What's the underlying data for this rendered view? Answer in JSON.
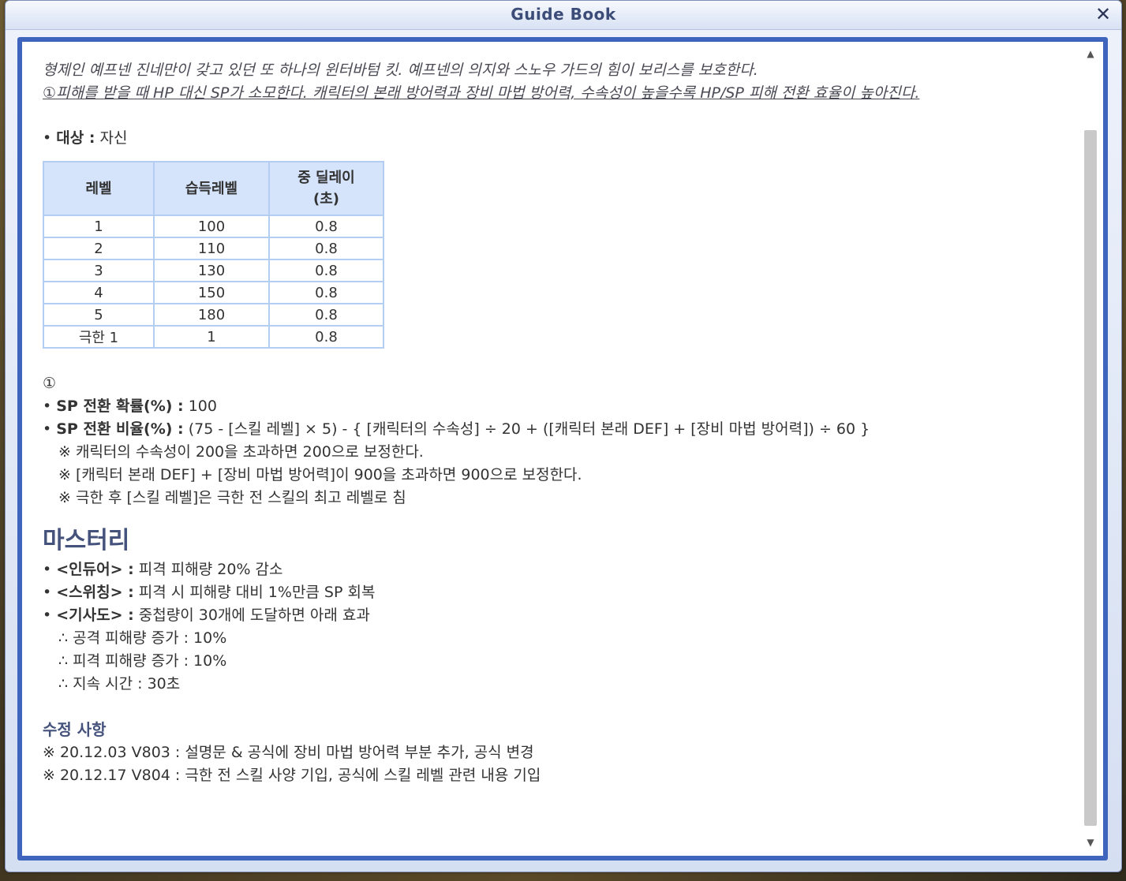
{
  "window": {
    "title": "Guide Book",
    "close_icon": "✕"
  },
  "intro": {
    "line1": "형제인 예프넨 진네만이 갖고 있던 또 하나의 윈터바텀 킷. 예프넨의 의지와 스노우 가드의 힘이 보리스를 보호한다.",
    "line2": "①피해를 받을 때 HP 대신 SP가 소모한다. 캐릭터의 본래 방어력과 장비 마법 방어력, 수속성이 높을수록 HP/SP 피해 전환 효율이 높아진다."
  },
  "target": {
    "label": "대상 :",
    "value": "자신"
  },
  "table": {
    "headers": [
      "레벨",
      "습득레벨",
      "중 딜레이\n(초)"
    ],
    "rows": [
      [
        "1",
        "100",
        "0.8"
      ],
      [
        "2",
        "110",
        "0.8"
      ],
      [
        "3",
        "130",
        "0.8"
      ],
      [
        "4",
        "150",
        "0.8"
      ],
      [
        "5",
        "180",
        "0.8"
      ],
      [
        "극한 1",
        "1",
        "0.8"
      ]
    ]
  },
  "formula": {
    "marker": "①",
    "prob_label": "SP 전환 확률(%) :",
    "prob_value": "100",
    "ratio_label": "SP 전환 비율(%) :",
    "ratio_value": "(75 - [스킬 레벨] × 5) - { [캐릭터의 수속성] ÷ 20 + ([캐릭터 본래 DEF] + [장비 마법 방어력]) ÷ 60 }",
    "notes": [
      "※ 캐릭터의 수속성이 200을 초과하면 200으로 보정한다.",
      "※ [캐릭터 본래 DEF] + [장비 마법 방어력]이 900을 초과하면 900으로 보정한다.",
      "※ 극한 후 [스킬 레벨]은 극한 전 스킬의 최고 레벨로 침"
    ]
  },
  "mastery": {
    "title": "마스터리",
    "items": [
      {
        "label": "<인듀어> :",
        "value": "피격 피해량 20% 감소"
      },
      {
        "label": "<스위칭> :",
        "value": "피격 시 피해량 대비 1%만큼 SP 회복"
      },
      {
        "label": "<기사도> :",
        "value": "중첩량이 30개에 도달하면 아래 효과"
      }
    ],
    "effects": [
      "∴ 공격 피해량 증가 : 10%",
      "∴ 피격 피해량 증가 : 10%",
      "∴ 지속 시간 : 30초"
    ]
  },
  "changes": {
    "title": "수정 사항",
    "items": [
      "※ 20.12.03 V803 : 설명문 & 공식에 장비 마법 방어력 부분 추가, 공식 변경",
      "※ 20.12.17 V804 : 극한 전 스킬 사양 기입, 공식에 스킬 레벨 관련 내용 기입"
    ]
  },
  "scrollbar": {
    "up_icon": "▲",
    "down_icon": "▼"
  },
  "colors": {
    "frame": "#3f64bd",
    "table_header": "#d5e4fb",
    "table_border": "#b3cdf3",
    "heading": "#44527c"
  }
}
